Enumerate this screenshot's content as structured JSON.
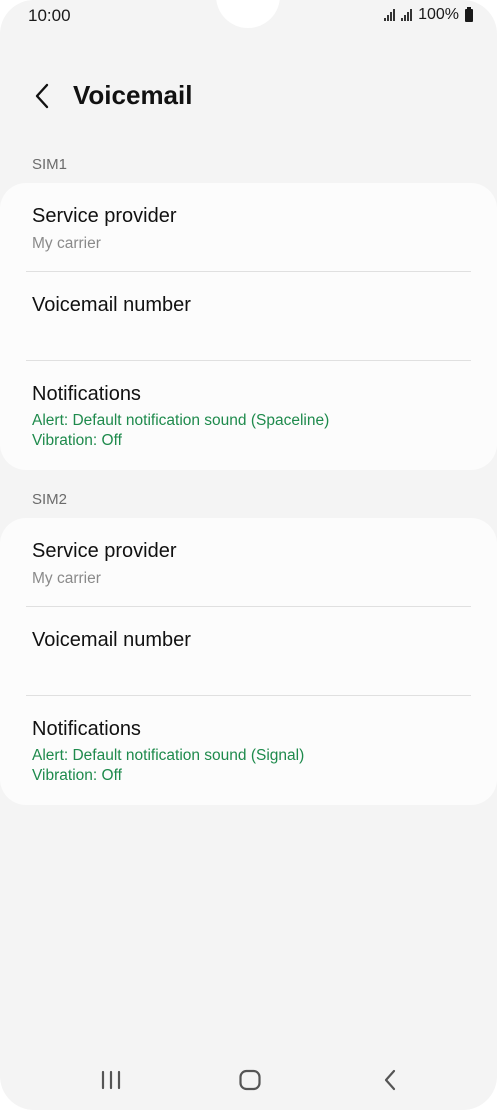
{
  "status_bar": {
    "time": "10:00",
    "battery": "100%"
  },
  "header": {
    "title": "Voicemail"
  },
  "sections": [
    {
      "label": "SIM1",
      "service_provider": {
        "title": "Service provider",
        "value": "My carrier"
      },
      "voicemail_number": {
        "title": "Voicemail number"
      },
      "notifications": {
        "title": "Notifications",
        "alert": "Alert: Default notification sound (Spaceline)",
        "vibration": "Vibration: Off"
      }
    },
    {
      "label": "SIM2",
      "service_provider": {
        "title": "Service provider",
        "value": "My carrier"
      },
      "voicemail_number": {
        "title": "Voicemail number"
      },
      "notifications": {
        "title": "Notifications",
        "alert": "Alert: Default notification sound (Signal)",
        "vibration": "Vibration: Off"
      }
    }
  ],
  "nav": {
    "recents_icon": "recents-icon",
    "home_icon": "home-icon",
    "back_icon": "back-icon"
  },
  "colors": {
    "accent_green": "#1e8a4c",
    "background": "#f4f4f4",
    "card": "#fcfcfc"
  }
}
